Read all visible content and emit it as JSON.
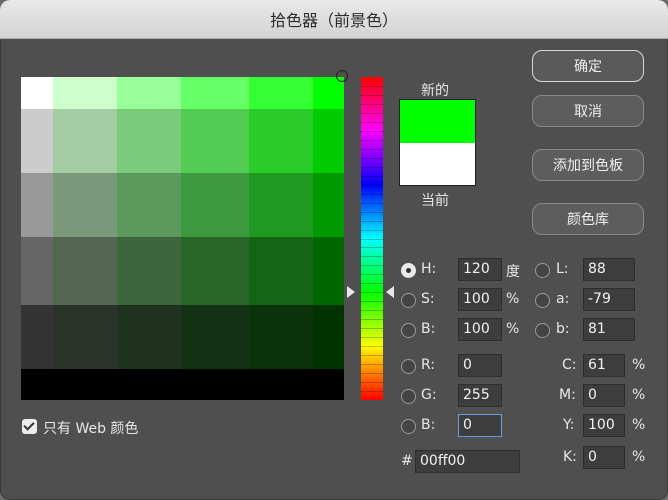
{
  "window": {
    "title": "拾色器（前景色）"
  },
  "preview": {
    "new_label": "新的",
    "current_label": "当前",
    "new_color": "#00ff00",
    "current_color": "#ffffff"
  },
  "buttons": {
    "ok": "确定",
    "cancel": "取消",
    "add_to_swatches": "添加到色板",
    "color_libraries": "颜色库"
  },
  "hsb": {
    "h": {
      "label": "H:",
      "value": "120",
      "unit": "度"
    },
    "s": {
      "label": "S:",
      "value": "100",
      "unit": "%"
    },
    "b": {
      "label": "B:",
      "value": "100",
      "unit": "%"
    }
  },
  "rgb": {
    "r": {
      "label": "R:",
      "value": "0"
    },
    "g": {
      "label": "G:",
      "value": "255"
    },
    "b": {
      "label": "B:",
      "value": "0"
    }
  },
  "lab": {
    "l": {
      "label": "L:",
      "value": "88"
    },
    "a": {
      "label": "a:",
      "value": "-79"
    },
    "b": {
      "label": "b:",
      "value": "81"
    }
  },
  "cmyk": {
    "c": {
      "label": "C:",
      "value": "61",
      "unit": "%"
    },
    "m": {
      "label": "M:",
      "value": "0",
      "unit": "%"
    },
    "y": {
      "label": "Y:",
      "value": "100",
      "unit": "%"
    },
    "k": {
      "label": "K:",
      "value": "0",
      "unit": "%"
    }
  },
  "hex": {
    "label": "#",
    "value": "00ff00"
  },
  "web_only": {
    "label": "只有 Web 颜色",
    "checked": true
  },
  "field_bands": [
    "#1a1a1a",
    "#2a2a2a",
    "#3e3e3e",
    "#555555",
    "#707070",
    "#999999",
    "#cccccc"
  ],
  "accent_color": "#00ff00"
}
